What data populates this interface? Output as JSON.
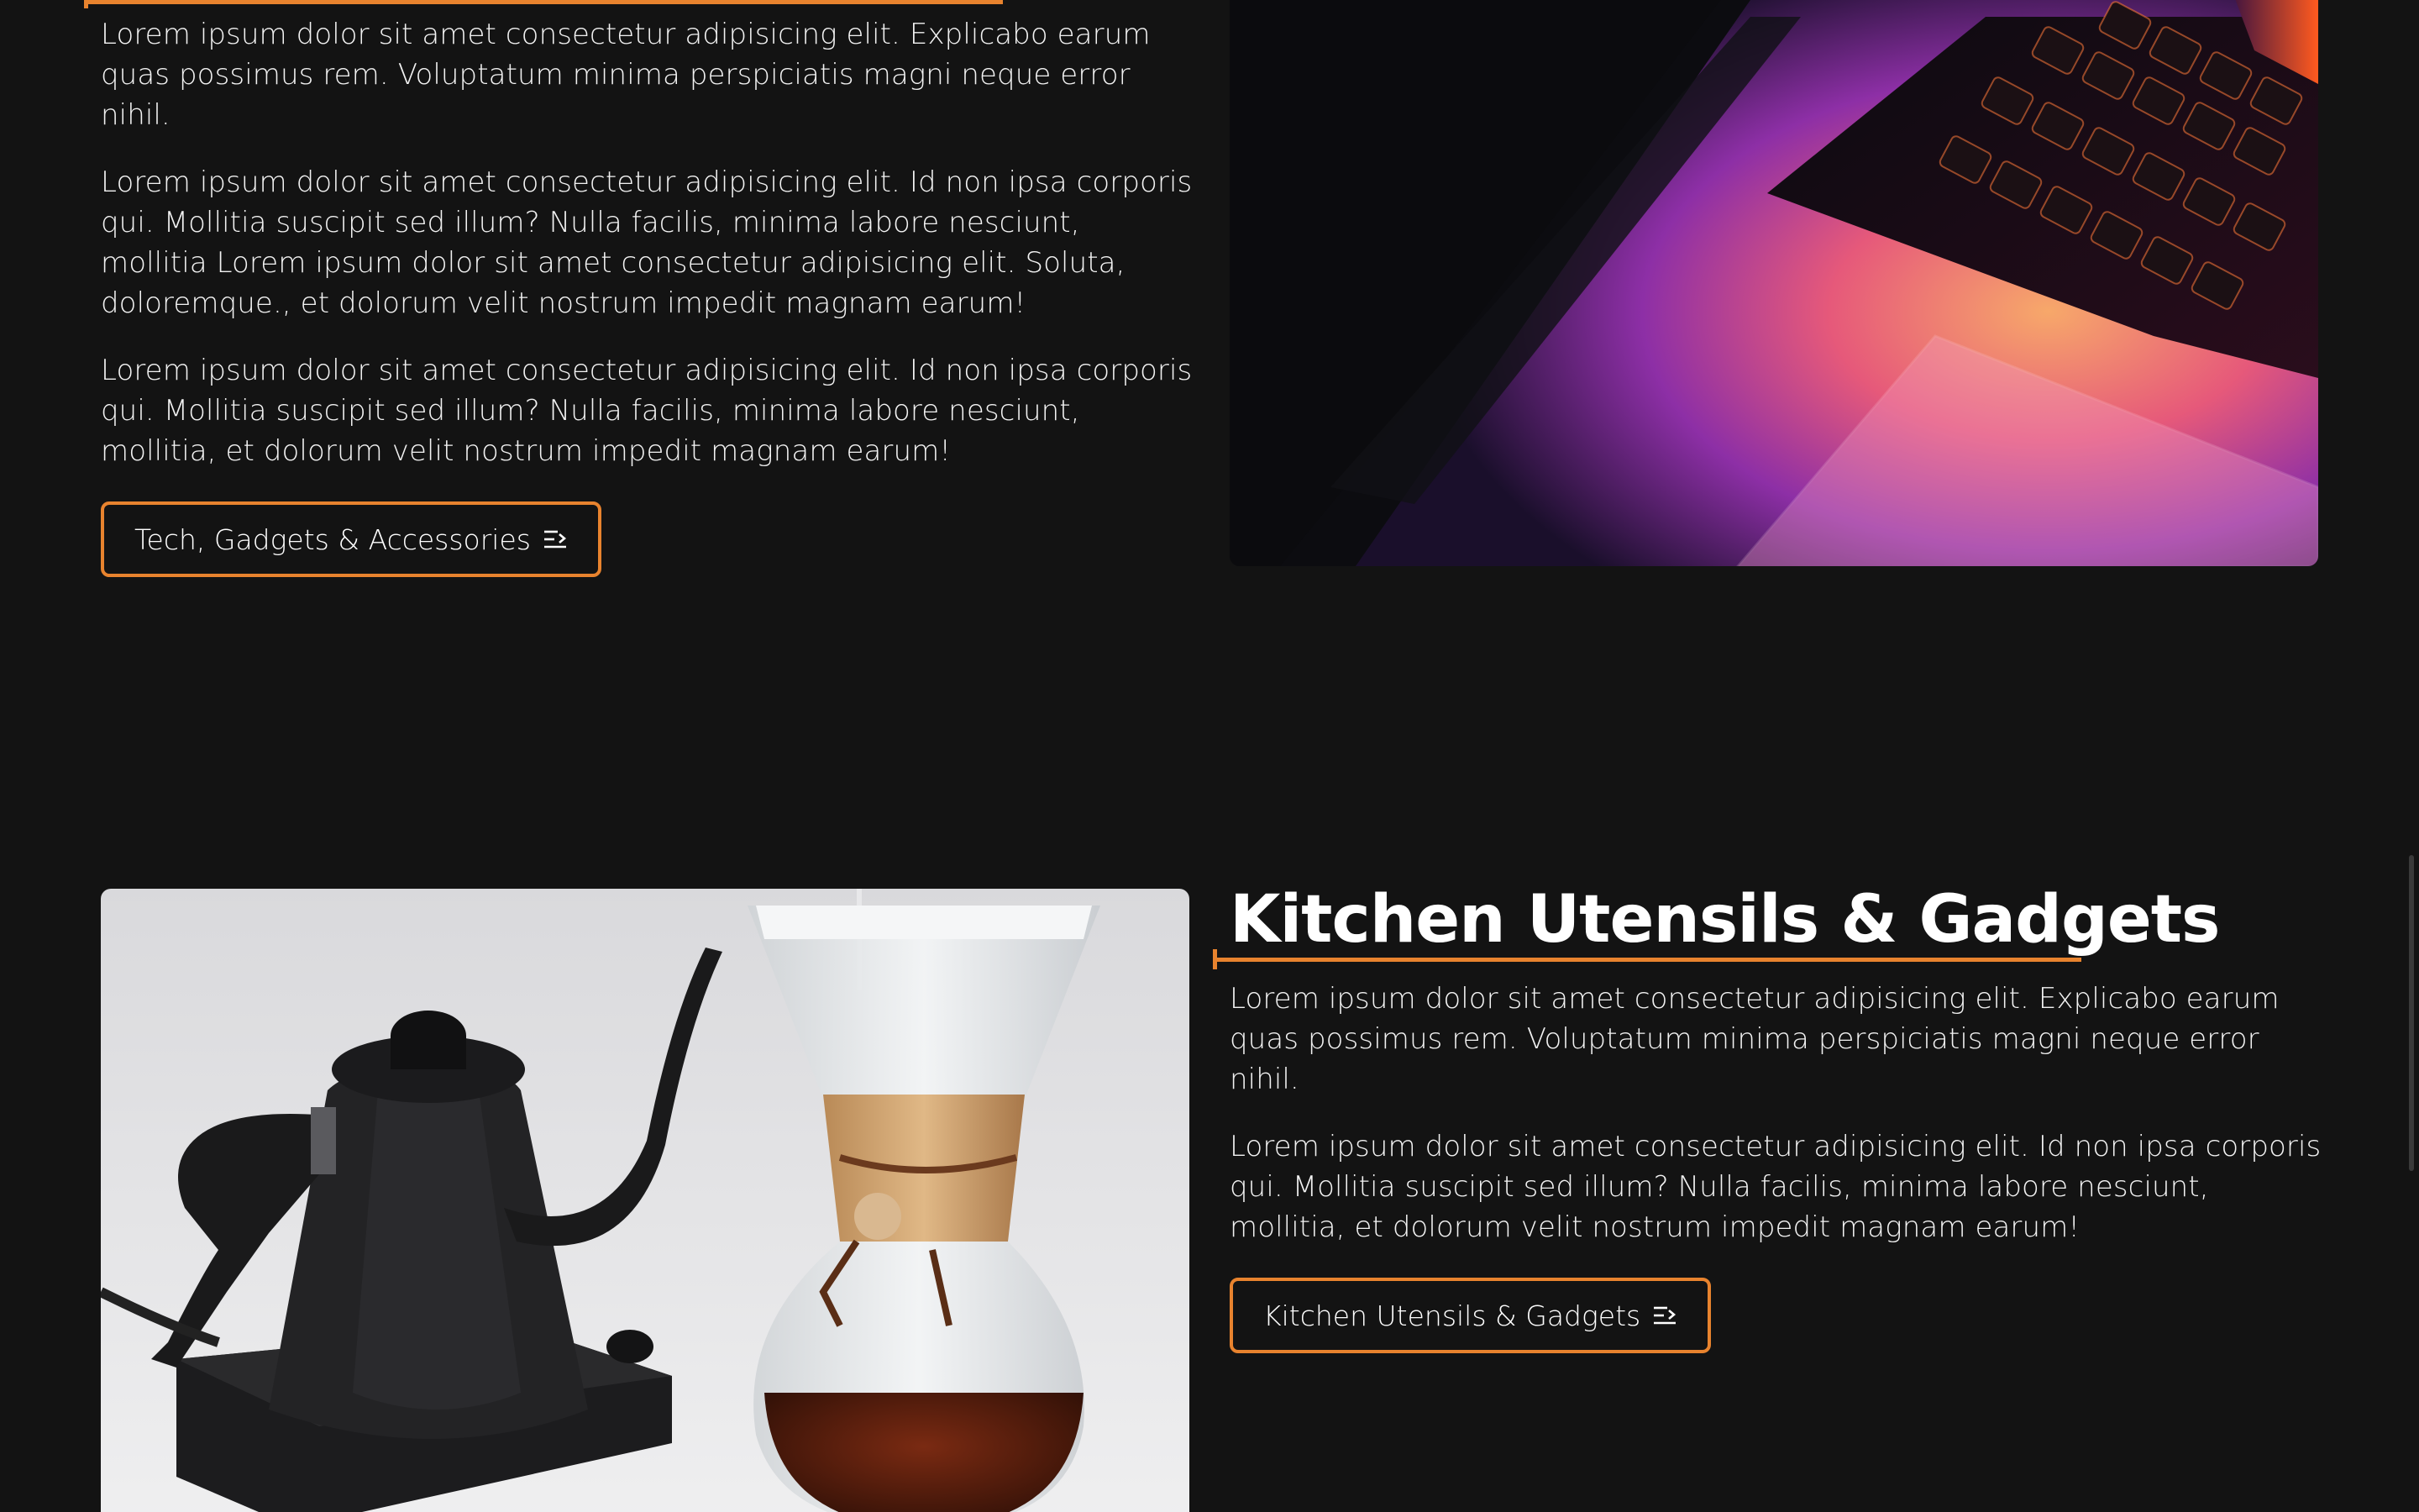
{
  "tech_section": {
    "paragraphs": [
      "Lorem ipsum dolor sit amet consectetur adipisicing elit. Explicabo earum quas possimus rem. Voluptatum minima perspiciatis magni neque error nihil.",
      "Lorem ipsum dolor sit amet consectetur adipisicing elit. Id non ipsa corporis qui. Mollitia suscipit sed illum? Nulla facilis, minima labore nesciunt, mollitia Lorem ipsum dolor sit amet consectetur adipisicing elit. Soluta, doloremque., et dolorum velit nostrum impedit magnam earum!",
      "Lorem ipsum dolor sit amet consectetur adipisicing elit. Id non ipsa corporis qui. Mollitia suscipit sed illum? Nulla facilis, minima labore nesciunt, mollitia, et dolorum velit nostrum impedit magnam earum!"
    ],
    "button_label": "Tech, Gadgets & Accessories",
    "image_icon": "laptop-keyboard-photo"
  },
  "kitchen_section": {
    "heading": "Kitchen Utensils & Gadgets",
    "paragraphs": [
      "Lorem ipsum dolor sit amet consectetur adipisicing elit. Explicabo earum quas possimus rem. Voluptatum minima perspiciatis magni neque error nihil.",
      "Lorem ipsum dolor sit amet consectetur adipisicing elit. Id non ipsa corporis qui. Mollitia suscipit sed illum? Nulla facilis, minima labore nesciunt, mollitia, et dolorum velit nostrum impedit magnam earum!"
    ],
    "button_label": "Kitchen Utensils & Gadgets",
    "image_icon": "kettle-coffee-photo"
  },
  "colors": {
    "background": "#131313",
    "accent": "#e8832e",
    "text": "#ffffff"
  },
  "icons": {
    "button_icon": "arrow-list-icon"
  }
}
